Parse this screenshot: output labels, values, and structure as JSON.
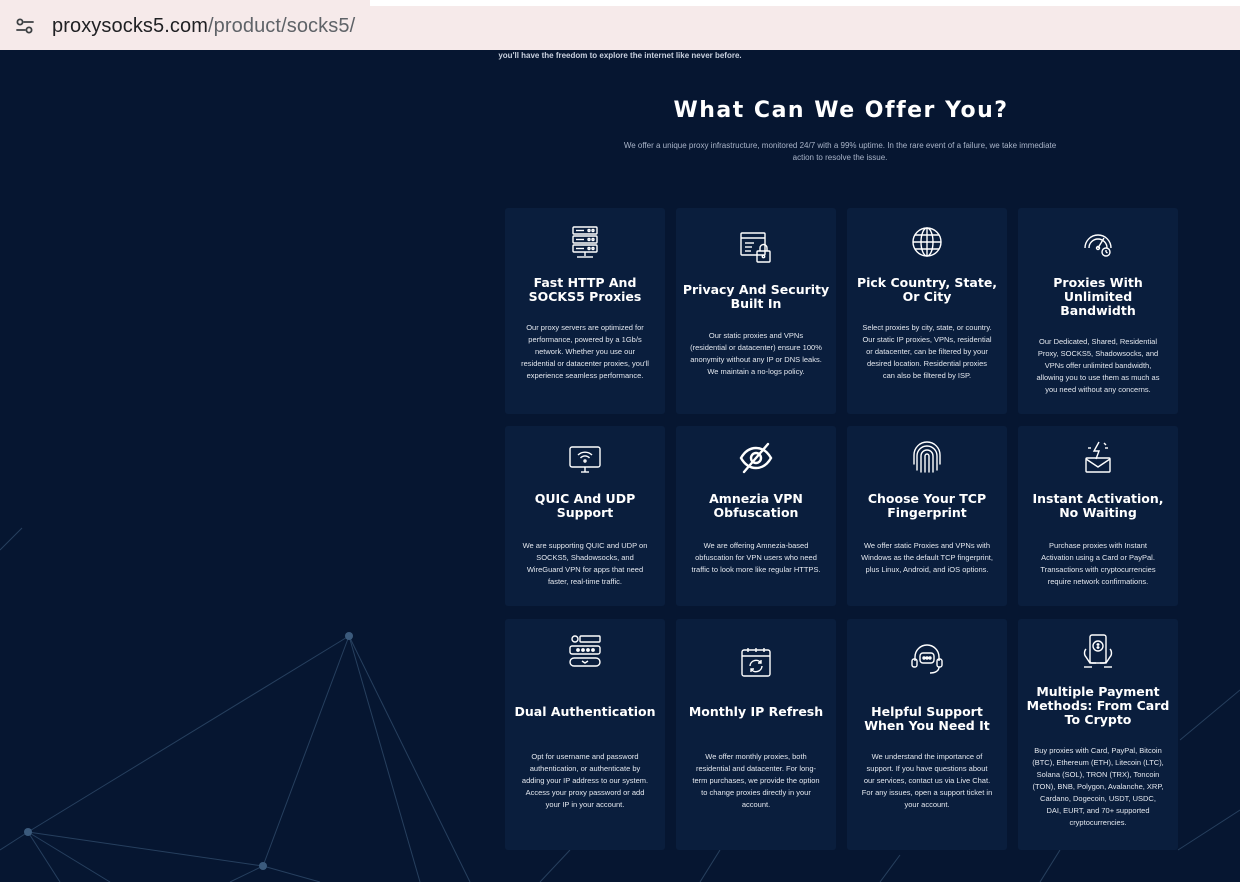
{
  "browser": {
    "url_host": "proxysocks5.com",
    "url_path": "/product/socks5/",
    "site_info_icon": "tune-icon"
  },
  "page": {
    "cut_text": "you'll have the freedom to explore the internet like never before.",
    "title": "What Can We Offer You?",
    "subtitle": "We offer a unique proxy infrastructure, monitored 24/7 with a 99% uptime. In the rare event of a failure, we take immediate action to resolve the issue.",
    "background_color": "#061631",
    "card_color": "#0a1e3d"
  },
  "features": [
    {
      "icon": "server-icon",
      "title": "Fast HTTP And SOCKS5 Proxies",
      "desc": "Our proxy servers are optimized for performance, powered by a 1Gb/s network. Whether you use our residential or datacenter proxies, you'll experience seamless performance."
    },
    {
      "icon": "security-lock-icon",
      "title": "Privacy And Security Built In",
      "desc": "Our static proxies and VPNs (residential or datacenter) ensure 100% anonymity without any IP or DNS leaks. We maintain a no-logs policy."
    },
    {
      "icon": "globe-icon",
      "title": "Pick Country, State, Or City",
      "desc": "Select proxies by city, state, or country. Our static IP proxies, VPNs, residential or datacenter, can be filtered by your desired location. Residential proxies can also be filtered by ISP."
    },
    {
      "icon": "speedometer-icon",
      "title": "Proxies With Unlimited Bandwidth",
      "desc": "Our Dedicated, Shared, Residential Proxy, SOCKS5, Shadowsocks, and VPNs offer unlimited bandwidth, allowing you to use them as much as you need without any concerns."
    },
    {
      "icon": "monitor-wifi-icon",
      "title": "QUIC And UDP Support",
      "desc": "We are supporting QUIC and UDP on SOCKS5, Shadowsocks, and WireGuard VPN for apps that need faster, real-time traffic."
    },
    {
      "icon": "eye-slash-icon",
      "title": "Amnezia VPN Obfuscation",
      "desc": "We are offering Amnezia-based obfuscation for VPN users who need traffic to look more like regular HTTPS."
    },
    {
      "icon": "fingerprint-icon",
      "title": "Choose Your TCP Fingerprint",
      "desc": "We offer static Proxies and VPNs with Windows as the default TCP fingerprint, plus Linux, Android, and iOS options."
    },
    {
      "icon": "lightning-mail-icon",
      "title": "Instant Activation, No Waiting",
      "desc": "Purchase proxies with Instant Activation using a Card or PayPal. Transactions with cryptocurrencies require network confirmations."
    },
    {
      "icon": "password-key-icon",
      "title": "Dual Authentication",
      "desc": "Opt for username and password authentication, or authenticate by adding your IP address to our system. Access your proxy password or add your IP in your account."
    },
    {
      "icon": "calendar-refresh-icon",
      "title": "Monthly IP Refresh",
      "desc": "We offer monthly proxies, both residential and datacenter. For long-term purchases, we provide the option to change proxies directly in your account."
    },
    {
      "icon": "headset-chat-icon",
      "title": "Helpful Support When You Need It",
      "desc": "We understand the importance of support. If you have questions about our services, contact us via Live Chat. For any issues, open a support ticket in your account."
    },
    {
      "icon": "mobile-payment-icon",
      "title": "Multiple Payment Methods: From Card To Crypto",
      "desc": "Buy proxies with Card, PayPal, Bitcoin (BTC), Ethereum (ETH), Litecoin (LTC), Solana (SOL), TRON (TRX), Toncoin (TON), BNB, Polygon, Avalanche, XRP, Cardano, Dogecoin, USDT, USDC, DAI, EURT, and 70+ supported cryptocurrencies."
    }
  ]
}
